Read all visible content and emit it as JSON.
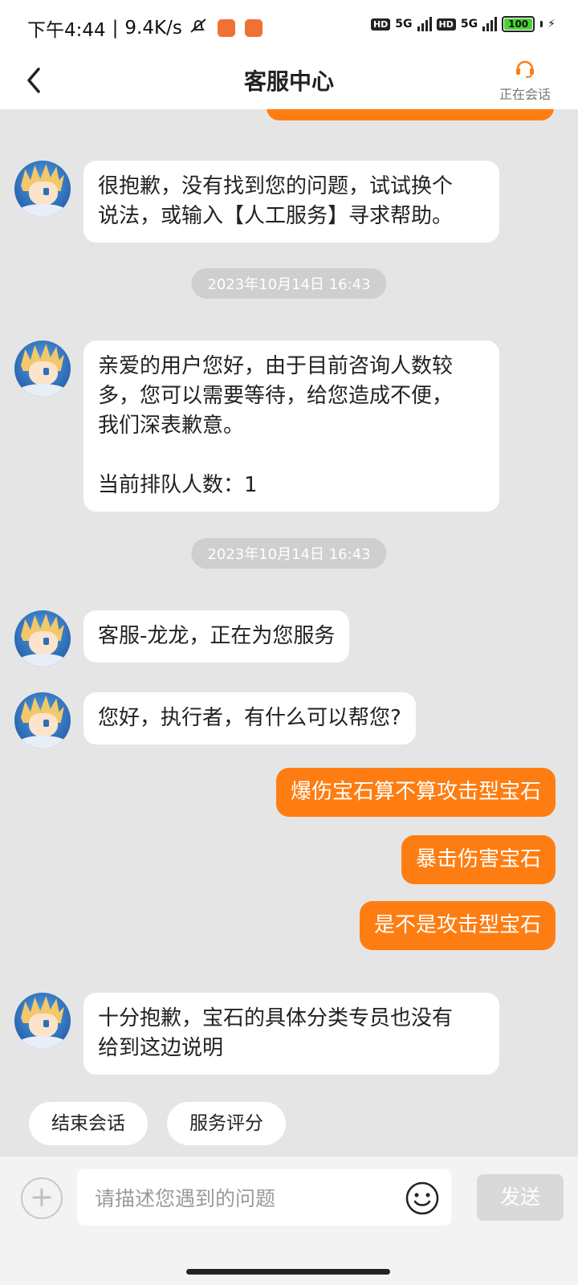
{
  "status_bar": {
    "time": "下午4:44",
    "speed": "9.4K/s",
    "network1": "5G",
    "network2": "5G",
    "hd": "HD",
    "battery": "100"
  },
  "header": {
    "title": "客服中心",
    "agent_label": "正在会话"
  },
  "timestamps": [
    "2023年10月14日 16:43",
    "2023年10月14日 16:43"
  ],
  "messages": {
    "m1": "很抱歉，没有找到您的问题，试试换个\n说法，或输入【人工服务】寻求帮助。",
    "m2": "亲爱的用户您好，由于目前咨询人数较\n多，您可以需要等待，给您造成不便，\n我们深表歉意。\n\n当前排队人数：1",
    "m3": "客服-龙龙，正在为您服务",
    "m4": "您好，执行者，有什么可以帮您?",
    "u1": "爆伤宝石算不算攻击型宝石",
    "u2": "暴击伤害宝石",
    "u3": "是不是攻击型宝石",
    "m5": "十分抱歉，宝石的具体分类专员也没有\n给到这边说明"
  },
  "quick_actions": [
    "结束会话",
    "服务评分"
  ],
  "input": {
    "placeholder": "请描述您遇到的问题",
    "send_label": "发送"
  },
  "colors": {
    "accent": "#fe7d12",
    "background": "#e5e5e5"
  }
}
